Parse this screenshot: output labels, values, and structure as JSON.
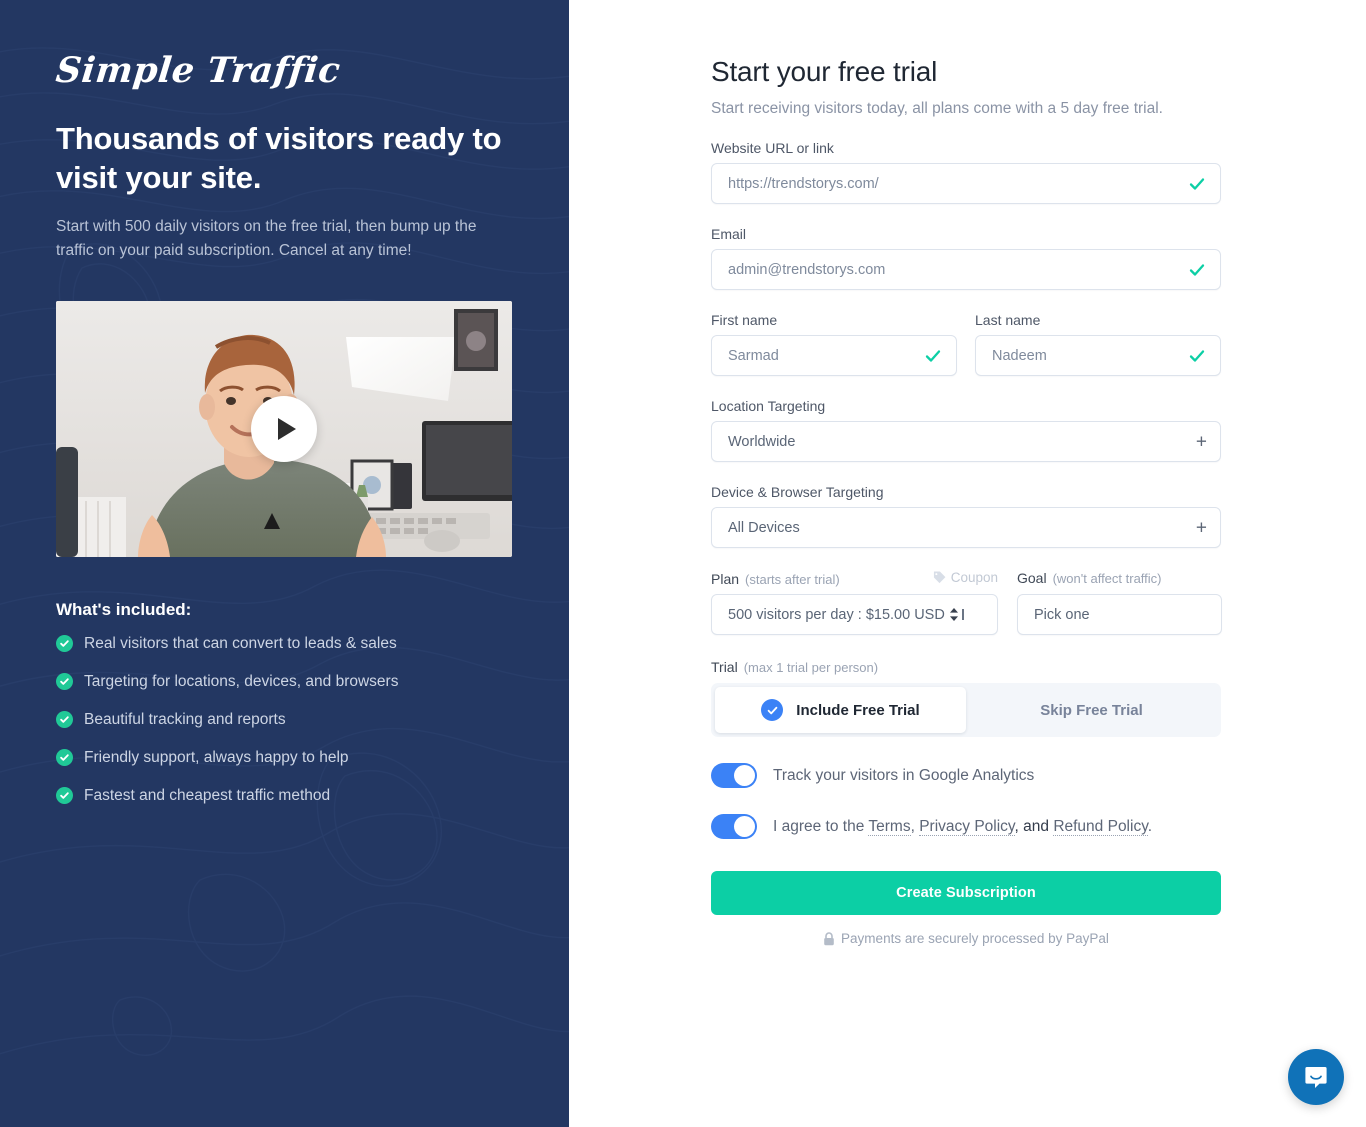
{
  "brand": {
    "logo_text": "Simple Traffic",
    "accent_teal": "#0ccfa5",
    "accent_green": "#20c997",
    "accent_blue": "#3b82f6",
    "panel_navy": "#233762",
    "chat_blue": "#1072b8"
  },
  "left": {
    "headline": "Thousands of visitors ready to visit your site.",
    "subhead": "Start with 500 daily visitors on the free trial, then bump up the traffic on your paid subscription. Cancel at any time!",
    "included_title": "What's included:",
    "features": [
      "Real visitors that can convert to leads & sales",
      "Targeting for locations, devices, and browsers",
      "Beautiful tracking and reports",
      "Friendly support, always happy to help",
      "Fastest and cheapest traffic method"
    ]
  },
  "form": {
    "title": "Start your free trial",
    "subtitle": "Start receiving visitors today, all plans come with a 5 day free trial.",
    "website": {
      "label": "Website URL or link",
      "value": "https://trendstorys.com/",
      "placeholder": "https://trendstorys.com/",
      "valid": "valid-check-icon"
    },
    "email": {
      "label": "Email",
      "value": "admin@trendstorys.com",
      "placeholder": "admin@trendstorys.com",
      "valid": "valid-check-icon"
    },
    "first_name": {
      "label": "First name",
      "value": "Sarmad",
      "placeholder": "Sarmad"
    },
    "last_name": {
      "label": "Last name",
      "value": "Nadeem",
      "placeholder": "Nadeem"
    },
    "location": {
      "label": "Location Targeting",
      "value": "Worldwide",
      "add_icon": "+"
    },
    "device": {
      "label": "Device & Browser Targeting",
      "value": "All Devices",
      "add_icon": "+"
    },
    "plan": {
      "label": "Plan",
      "note": "(starts after trial)",
      "value": "500 visitors per day : $15.00 USD",
      "coupon_label": "Coupon"
    },
    "goal": {
      "label": "Goal",
      "note": "(won't affect traffic)",
      "value": "Pick one",
      "placeholder": "Pick one"
    },
    "trial": {
      "label": "Trial",
      "note": "(max 1 trial per person)",
      "include_label": "Include Free Trial",
      "skip_label": "Skip Free Trial",
      "selected": "Include Free Trial"
    },
    "analytics_toggle": {
      "label": "Track your visitors in Google Analytics",
      "state": "on"
    },
    "agree_toggle": {
      "prefix": "I agree to the ",
      "terms": "Terms",
      "sep1": ", ",
      "privacy": "Privacy Policy",
      "sep2": ", and ",
      "refund": "Refund Policy",
      "suffix": ".",
      "state": "on"
    },
    "submit_label": "Create Subscription",
    "paypal_note": "Payments are securely processed by PayPal"
  },
  "chat": {
    "icon": "chat-bubble-icon"
  }
}
